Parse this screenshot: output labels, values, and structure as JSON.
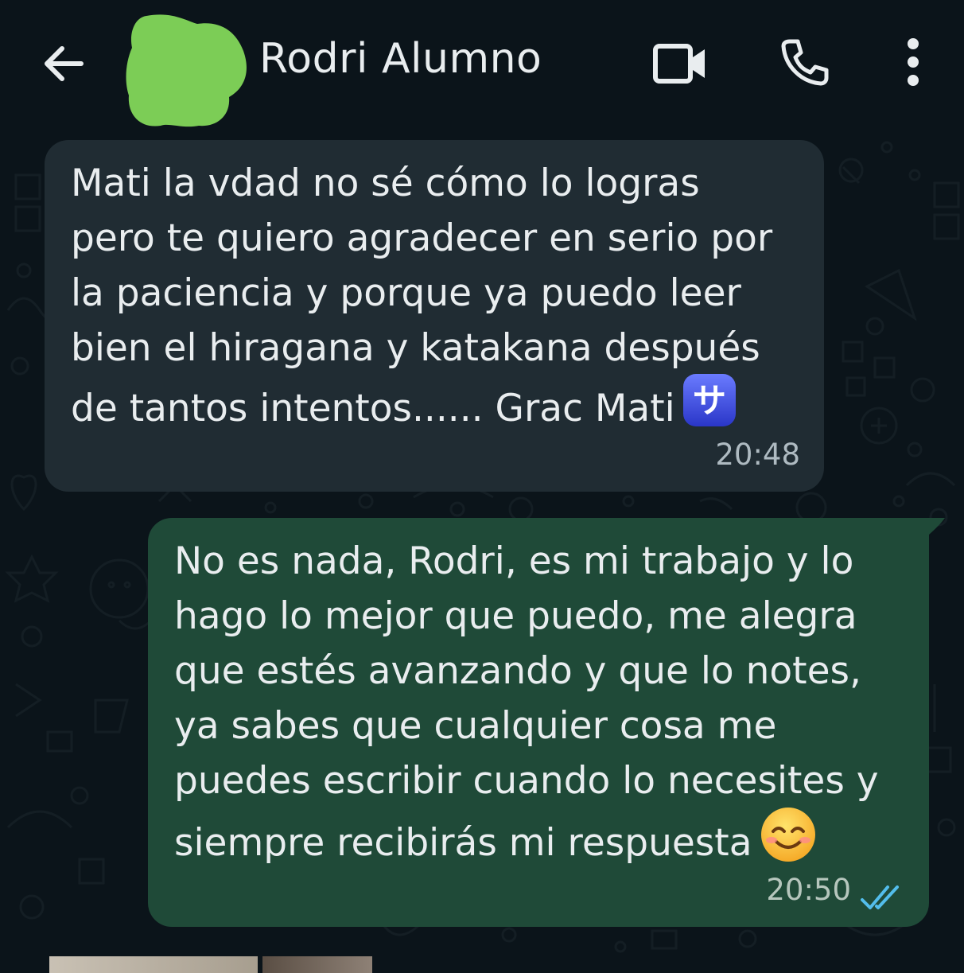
{
  "header": {
    "back_icon": "arrow-left-icon",
    "avatar_color": "#7ccd56",
    "contact_name": "Rodri Alumno",
    "video_icon": "video-camera-icon",
    "call_icon": "phone-icon",
    "menu_icon": "more-vertical-icon"
  },
  "messages": [
    {
      "direction": "incoming",
      "lines": [
        "Mati la vdad no sé cómo lo logras",
        "pero te quiero agradecer en serio por",
        "la paciencia y porque ya puedo leer",
        "bien el hiragana y katakana después",
        "de tantos intentos...... Grac Mati"
      ],
      "emoji": "サ",
      "emoji_name": "katakana-sa-emoji",
      "time": "20:48"
    },
    {
      "direction": "outgoing",
      "lines": [
        "No es nada, Rodri, es mi trabajo y lo",
        "hago lo mejor que puedo, me alegra",
        "que estés avanzando y que lo notes,",
        "ya sabes que cualquier cosa me",
        "puedes escribir cuando lo necesites y",
        "siempre recibirás mi respuesta"
      ],
      "emoji_name": "smiling-face-with-smiling-eyes-emoji",
      "time": "20:50",
      "status_icon": "double-check-read-icon"
    }
  ],
  "colors": {
    "background": "#0b141a",
    "incoming_bubble": "#202c33",
    "outgoing_bubble": "#1f4a38",
    "read_ticks": "#53bdeb"
  }
}
